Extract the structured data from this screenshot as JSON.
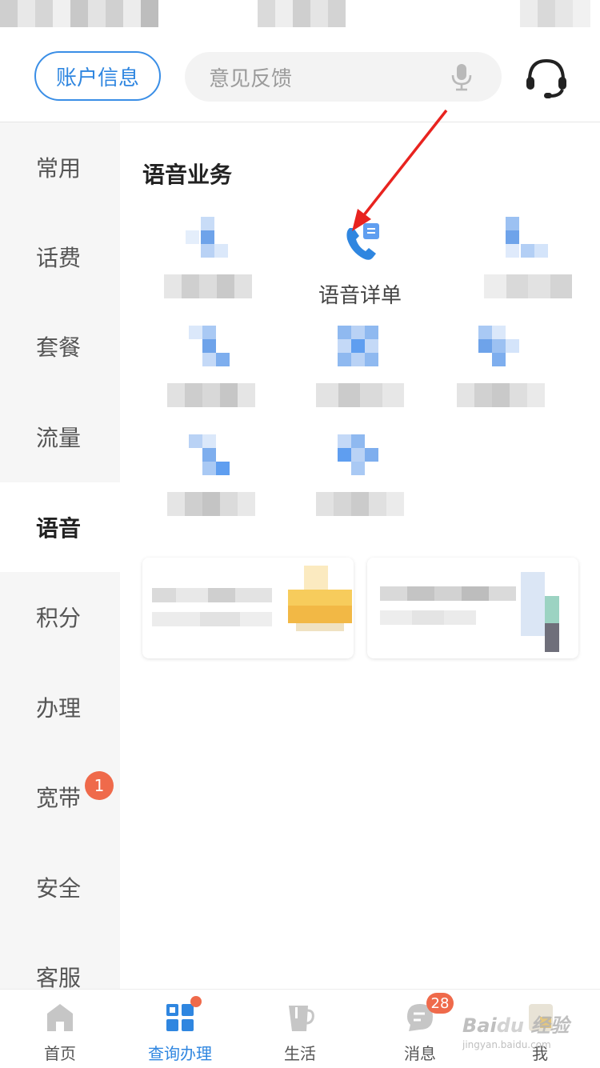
{
  "header": {
    "account_button": "账户信息",
    "search_placeholder": "意见反馈",
    "mic_icon": "microphone-icon",
    "headset_icon": "customer-service-headset-icon"
  },
  "sidebar": {
    "items": [
      {
        "label": "常用"
      },
      {
        "label": "话费"
      },
      {
        "label": "套餐"
      },
      {
        "label": "流量"
      },
      {
        "label": "语音",
        "active": true
      },
      {
        "label": "积分"
      },
      {
        "label": "办理"
      },
      {
        "label": "宽带",
        "badge": "1"
      },
      {
        "label": "安全"
      },
      {
        "label": "客服"
      }
    ]
  },
  "main": {
    "section_title": "语音业务",
    "feature": {
      "label": "语音详单",
      "icon": "phone-record-icon"
    }
  },
  "tabbar": {
    "tabs": [
      {
        "label": "首页",
        "icon": "home-icon"
      },
      {
        "label": "查询办理",
        "icon": "grid-apps-icon",
        "active": true
      },
      {
        "label": "生活",
        "icon": "cup-icon"
      },
      {
        "label": "消息",
        "icon": "message-icon",
        "badge": "28"
      },
      {
        "label": "我",
        "icon": "user-icon"
      }
    ]
  },
  "colors": {
    "accent": "#2f86e0",
    "badge": "#ef6a4b",
    "sidebar_bg": "#f6f6f6",
    "arrow": "#e8231f"
  }
}
